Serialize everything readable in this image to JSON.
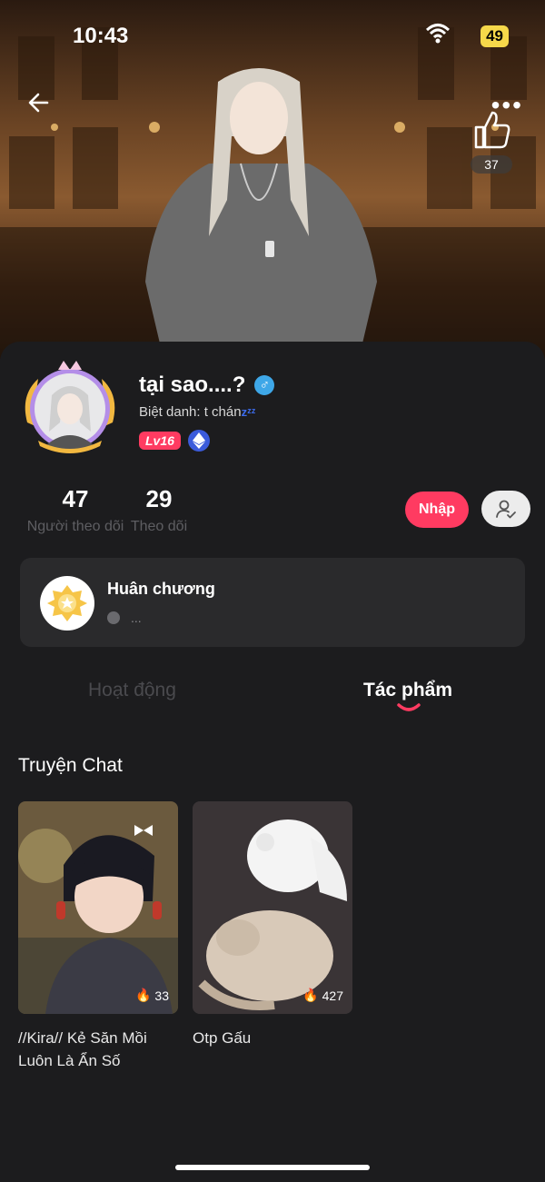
{
  "status_bar": {
    "time": "10:43",
    "battery": "49"
  },
  "hero": {
    "like_count": "37"
  },
  "profile": {
    "username": "tại sao....?",
    "gender_symbol": "♂",
    "nickname": "Biệt danh: t chán",
    "nickname_emoji": "zᶻᶻ",
    "level": "Lv16"
  },
  "stats": [
    {
      "value": "47",
      "label": "Người theo dõi"
    },
    {
      "value": "29",
      "label": "Theo dõi"
    }
  ],
  "actions": {
    "nhap_label": "Nhập"
  },
  "medal": {
    "title": "Huân chương",
    "sub": "..."
  },
  "tabs": [
    {
      "label": "Hoạt động"
    },
    {
      "label": "Tác phẩm"
    }
  ],
  "section": {
    "title": "Truyện Chat"
  },
  "stories": [
    {
      "title": "//Kira// Kẻ Săn Mồi Luôn Là Ẩn Số",
      "views": "33"
    },
    {
      "title": "Otp Gấu",
      "views": "427"
    }
  ],
  "colors": {
    "accent": "#ff3b61",
    "background": "#1c1c1e",
    "card": "#2a2a2c"
  }
}
